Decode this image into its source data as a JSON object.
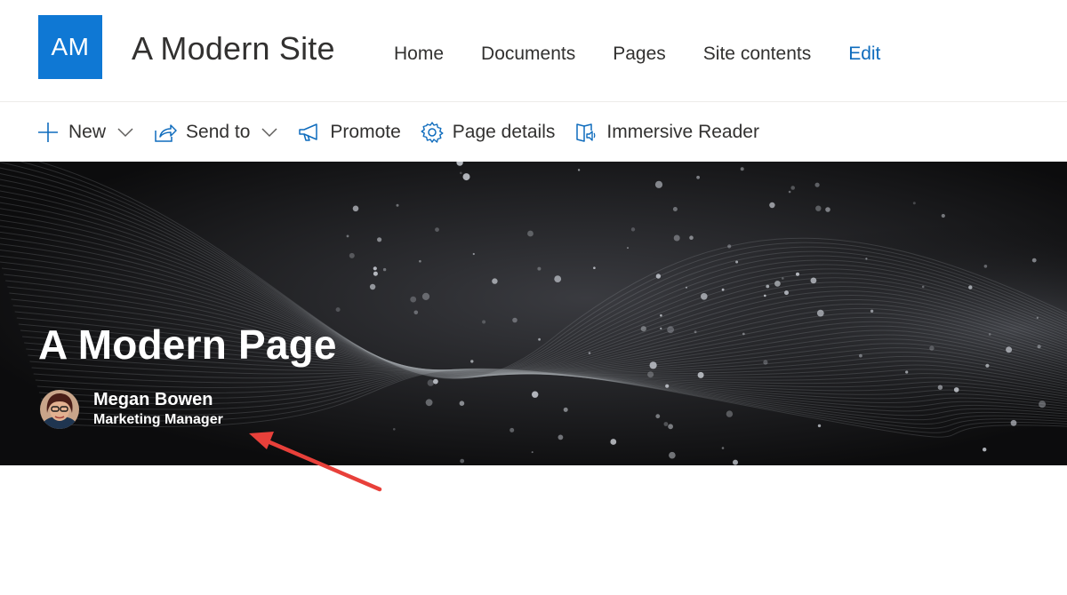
{
  "site": {
    "logo_initials": "AM",
    "title": "A Modern Site",
    "nav": [
      {
        "label": "Home"
      },
      {
        "label": "Documents"
      },
      {
        "label": "Pages"
      },
      {
        "label": "Site contents"
      },
      {
        "label": "Edit"
      }
    ],
    "logo_color": "#0f78d4",
    "accent_color": "#0f6cbd"
  },
  "command_bar": {
    "items": [
      {
        "label": "New",
        "icon": "plus-icon",
        "has_dropdown": true
      },
      {
        "label": "Send to",
        "icon": "share-icon",
        "has_dropdown": true
      },
      {
        "label": "Promote",
        "icon": "megaphone-icon",
        "has_dropdown": false
      },
      {
        "label": "Page details",
        "icon": "gear-icon",
        "has_dropdown": false
      },
      {
        "label": "Immersive Reader",
        "icon": "immersive-reader-icon",
        "has_dropdown": false
      }
    ]
  },
  "hero": {
    "page_title": "A Modern Page",
    "author_name": "Megan Bowen",
    "author_role": "Marketing Manager"
  },
  "annotation": {
    "arrow_color": "#e8403a"
  }
}
